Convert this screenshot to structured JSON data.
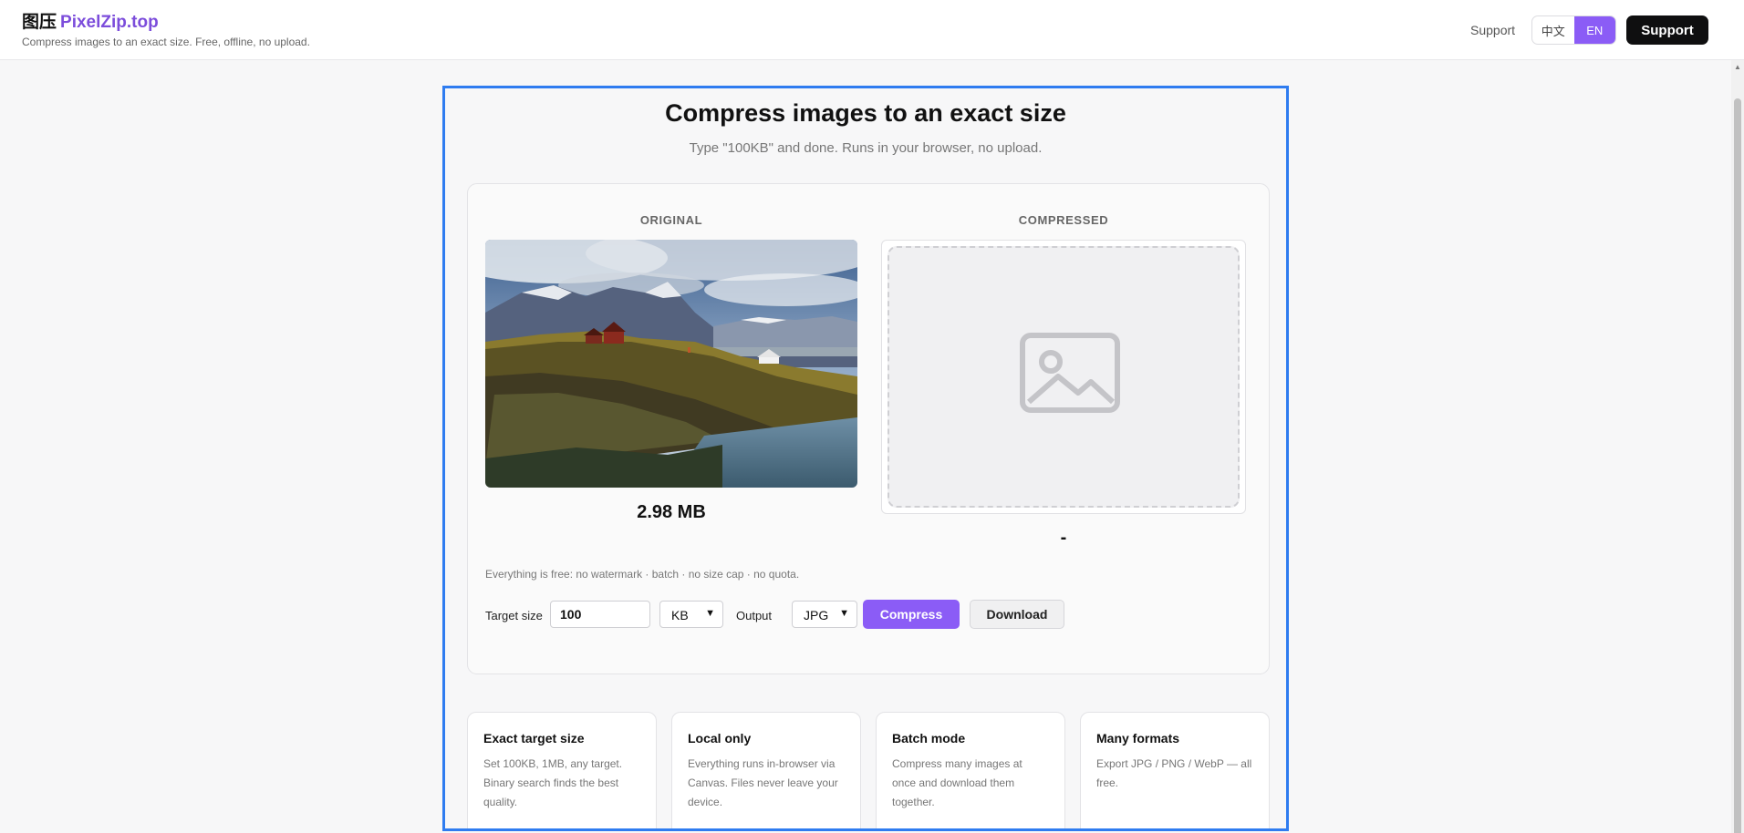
{
  "header": {
    "brand_cn": "图压",
    "brand_en": "PixelZip.top",
    "tagline": "Compress images to an exact size. Free, offline, no upload.",
    "support_link": "Support",
    "lang_cn": "中文",
    "lang_en": "EN",
    "support_button": "Support"
  },
  "hero": {
    "title": "Compress images to an exact size",
    "subtitle": "Type \"100KB\" and done. Runs in your browser, no upload."
  },
  "compare": {
    "original_label": "ORIGINAL",
    "compressed_label": "COMPRESSED",
    "original_size": "2.98 MB",
    "compressed_size": "-"
  },
  "notice": "Everything is free: no watermark · batch · no size cap · no quota.",
  "controls": {
    "target_label": "Target size",
    "target_value": "100",
    "unit": "KB",
    "output_label": "Output",
    "output_format": "JPG",
    "compress_button": "Compress",
    "download_button": "Download"
  },
  "features": [
    {
      "title": "Exact target size",
      "text": "Set 100KB, 1MB, any target. Binary search finds the best quality."
    },
    {
      "title": "Local only",
      "text": "Everything runs in-browser via Canvas. Files never leave your device."
    },
    {
      "title": "Batch mode",
      "text": "Compress many images at once and download them together."
    },
    {
      "title": "Many formats",
      "text": "Export JPG / PNG / WebP — all free."
    }
  ],
  "colors": {
    "accent": "#8b5cf6",
    "frame": "#2f7cf0",
    "dark_button": "#0f0f10"
  },
  "icons": [
    "image-placeholder-icon",
    "chevron-down-icon"
  ]
}
